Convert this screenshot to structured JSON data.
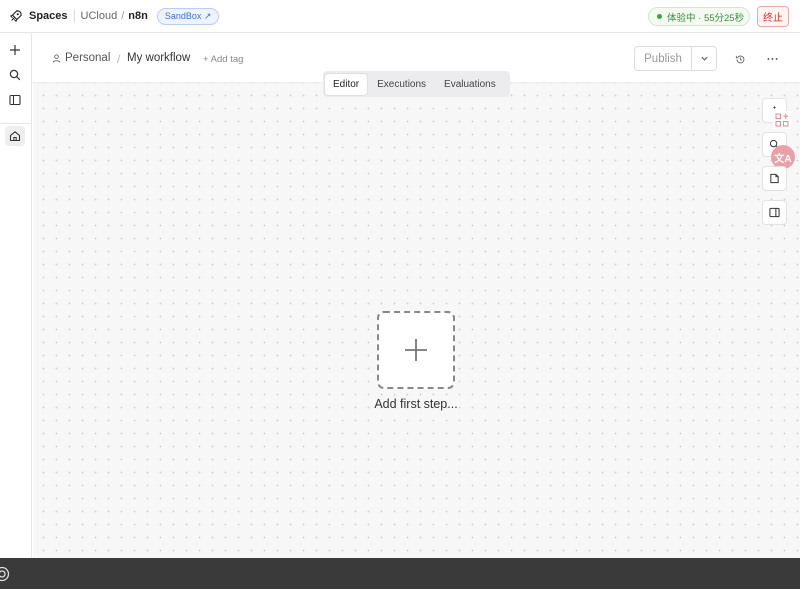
{
  "topbar": {
    "brand": "Spaces",
    "crumb_ucloud": "UCloud",
    "crumb_slash": "/",
    "crumb_app": "n8n",
    "sandbox_badge": "SandBox ↗",
    "trial_status": "体验中 · 55分25秒",
    "stop_label": "终止"
  },
  "workflow": {
    "project": "Personal",
    "separator": "/",
    "name": "My workflow",
    "add_tag": "+ Add tag",
    "publish_label": "Publish"
  },
  "tabs": [
    {
      "label": "Editor",
      "active": true
    },
    {
      "label": "Executions",
      "active": false
    },
    {
      "label": "Evaluations",
      "active": false
    }
  ],
  "canvas": {
    "add_first_step": "Add first step..."
  },
  "translate": {
    "glyph": "文A"
  },
  "icons": {
    "sidebar": [
      "plus-icon",
      "search-icon",
      "panel-icon",
      "home-icon"
    ],
    "right_tools": [
      "zoom-fit-icon",
      "search-icon",
      "sticky-note-icon",
      "side-panel-icon"
    ]
  },
  "colors": {
    "sandbox": "#3d6fd8",
    "trial": "#3e8a3e",
    "stop": "#d92c2c",
    "bottombar": "#3a3a3a"
  }
}
